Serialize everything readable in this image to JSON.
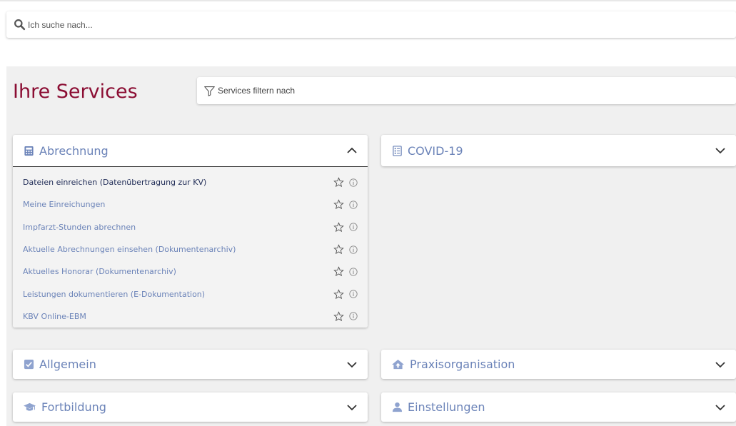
{
  "search": {
    "placeholder": "Ich suche nach..."
  },
  "services": {
    "title": "Ihre Services",
    "filter_placeholder": "Services filtern nach"
  },
  "cards": {
    "abrechnung": {
      "label": "Abrechnung",
      "items": [
        "Dateien einreichen (Datenübertragung zur KV)",
        "Meine Einreichungen",
        "Impfarzt-Stunden abrechnen",
        "Aktuelle Abrechnungen einsehen (Dokumentenarchiv)",
        "Aktuelles Honorar (Dokumentenarchiv)",
        "Leistungen dokumentieren (E-Dokumentation)",
        "KBV Online-EBM"
      ]
    },
    "covid": {
      "label": "COVID-19"
    },
    "allgemein": {
      "label": "Allgemein"
    },
    "praxis": {
      "label": "Praxisorganisation"
    },
    "fortbildung": {
      "label": "Fortbildung"
    },
    "einstellungen": {
      "label": "Einstellungen"
    }
  },
  "colors": {
    "title": "#8b0d33",
    "link": "#6b83b8",
    "icon": "#6b83b8"
  }
}
